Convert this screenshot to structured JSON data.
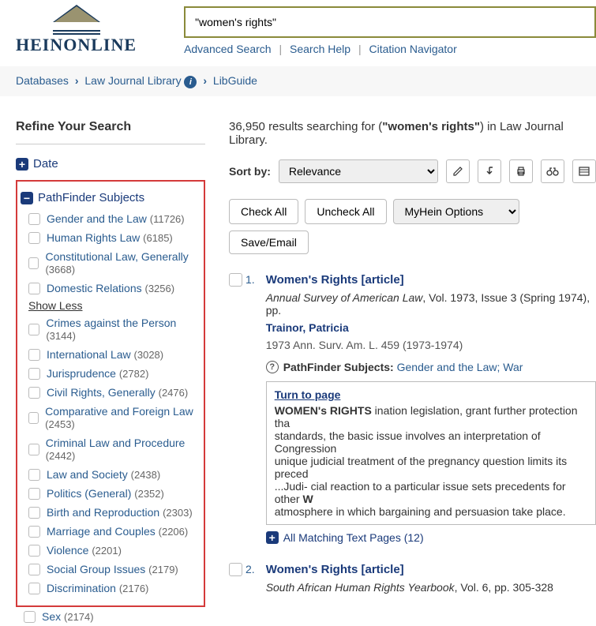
{
  "logo": {
    "text": "HEINONLINE"
  },
  "search": {
    "value": "\"women's rights\"",
    "links": {
      "advanced": "Advanced Search",
      "help": "Search Help",
      "citation": "Citation Navigator"
    }
  },
  "breadcrumb": {
    "databases": "Databases",
    "library": "Law Journal Library",
    "libguide": "LibGuide"
  },
  "sidebar": {
    "title": "Refine Your Search",
    "date_facet": "Date",
    "pf_title": "PathFinder Subjects",
    "show_less": "Show Less",
    "items": [
      {
        "label": "Gender and the Law",
        "count": "(11726)"
      },
      {
        "label": "Human Rights Law",
        "count": "(6185)"
      },
      {
        "label": "Constitutional Law, Generally",
        "count": "(3668)"
      },
      {
        "label": "Domestic Relations",
        "count": "(3256)"
      }
    ],
    "more_items": [
      {
        "label": "Crimes against the Person",
        "count": "(3144)"
      },
      {
        "label": "International Law",
        "count": "(3028)"
      },
      {
        "label": "Jurisprudence",
        "count": "(2782)"
      },
      {
        "label": "Civil Rights, Generally",
        "count": "(2476)"
      },
      {
        "label": "Comparative and Foreign Law",
        "count": "(2453)"
      },
      {
        "label": "Criminal Law and Procedure",
        "count": "(2442)"
      },
      {
        "label": "Law and Society",
        "count": "(2438)"
      },
      {
        "label": "Politics (General)",
        "count": "(2352)"
      },
      {
        "label": "Birth and Reproduction",
        "count": "(2303)"
      },
      {
        "label": "Marriage and Couples",
        "count": "(2206)"
      },
      {
        "label": "Violence",
        "count": "(2201)"
      },
      {
        "label": "Social Group Issues",
        "count": "(2179)"
      },
      {
        "label": "Discrimination",
        "count": "(2176)"
      }
    ],
    "overflow": {
      "label": "Sex",
      "count": "(2174)"
    }
  },
  "results_header": {
    "count": "36,950",
    "prefix": "results searching for (",
    "term": "\"women's rights\"",
    "suffix": ") in Law Journal Library."
  },
  "sort": {
    "label": "Sort by:",
    "value": "Relevance"
  },
  "actions": {
    "check_all": "Check All",
    "uncheck_all": "Uncheck All",
    "myhein": "MyHein Options",
    "save": "Save/Email"
  },
  "results": [
    {
      "num": "1.",
      "title": "Women's Rights [article]",
      "journal": "Annual Survey of American Law",
      "meta_rest": ", Vol. 1973, Issue 3 (Spring 1974), pp.",
      "author": "Trainor, Patricia",
      "cite": "1973 Ann. Surv. Am. L. 459 (1973-1974)",
      "pf_label": "PathFinder Subjects:",
      "pf_values": "Gender and the Law; War",
      "snippet": {
        "turn": "Turn to page",
        "hl": "WOMEN's RIGHTS",
        "line1": " ination legislation, grant further protection tha",
        "line2": "standards, the basic issue involves an interpretation of Congression",
        "line3": "unique judicial treatment of the pregnancy question limits its preced",
        "line4": "...Judi- cial reaction to a particular issue sets precedents for other ",
        "line4_hl": "W",
        "line5": "atmosphere in which bargaining and persuasion take place."
      },
      "all_matching": "All Matching Text Pages (12)"
    },
    {
      "num": "2.",
      "title": "Women's Rights [article]",
      "journal": "South African Human Rights Yearbook",
      "meta_rest": ", Vol. 6, pp. 305-328"
    }
  ]
}
